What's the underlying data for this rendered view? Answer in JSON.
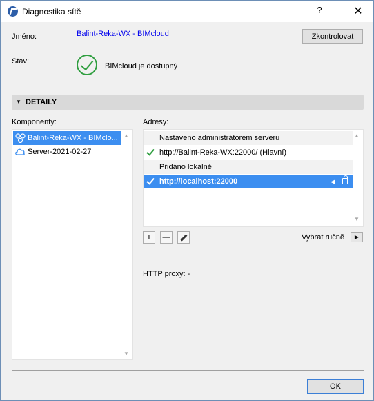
{
  "window": {
    "title": "Diagnostika sítě",
    "help": "?",
    "close": "✕"
  },
  "fields": {
    "name_label": "Jméno:",
    "name_value": "Balint-Reka-WX - BIMcloud",
    "status_label": "Stav:",
    "status_value": "BIMcloud je dostupný",
    "check_button": "Zkontrolovat"
  },
  "details": {
    "toggle": "▼",
    "title": "DETAILY",
    "components_label": "Komponenty:",
    "components": [
      {
        "label": "Balint-Reka-WX - BIMclo...",
        "icon": "network-icon",
        "selected": true
      },
      {
        "label": "Server-2021-02-27",
        "icon": "cloud-icon",
        "selected": false
      }
    ],
    "addresses_label": "Adresy:",
    "address_groups": [
      {
        "header": "Nastaveno administrátorem serveru"
      },
      {
        "row": "http://Balint-Reka-WX:22000/ (Hlavní)"
      },
      {
        "header": "Přidáno lokálně"
      },
      {
        "row": "http://localhost:22000"
      }
    ],
    "tool_add": "+",
    "tool_remove": "—",
    "select_manual": "Vybrat ručně",
    "select_arrow": "▶",
    "proxy": "HTTP proxy: -"
  },
  "footer": {
    "ok": "OK"
  },
  "colors": {
    "accent": "#3c8ef0",
    "success": "#2f9e3f"
  }
}
